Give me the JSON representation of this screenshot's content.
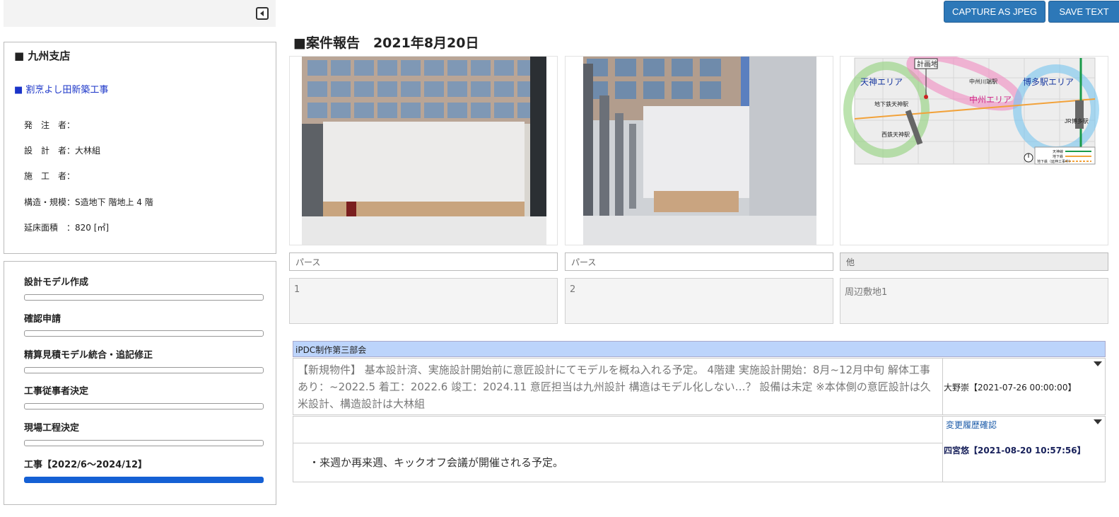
{
  "toolbar": {
    "capture_label": "CAPTURE AS JPEG",
    "save_label": "SAVE TEXT"
  },
  "info": {
    "branch": "■ 九州支店",
    "project": "■ 割烹よし田新築工事",
    "rows": [
      {
        "label": "発　注　者：",
        "value": ""
      },
      {
        "label": "設　計　者：",
        "value": "大林組"
      },
      {
        "label": "施　工　者：",
        "value": ""
      },
      {
        "label": "構造・規模：",
        "value": "S造地下 階地上 4 階"
      },
      {
        "label": "延床面積　：",
        "value": "820 [㎡]"
      }
    ]
  },
  "steps": [
    {
      "label": "設計モデル作成",
      "done": false
    },
    {
      "label": "確認申請",
      "done": false
    },
    {
      "label": "精算見積モデル統合・追記修正",
      "done": false
    },
    {
      "label": "工事従事者決定",
      "done": false
    },
    {
      "label": "現場工程決定",
      "done": false
    },
    {
      "label": "工事【2022/6～2024/12】",
      "done": true
    }
  ],
  "report": {
    "title": "■案件報告　2021年8月20日"
  },
  "images": [
    {
      "caption": "パース",
      "note": "1",
      "kind": "facade"
    },
    {
      "caption": "パース",
      "note": "2",
      "kind": "perspective"
    },
    {
      "caption": "他",
      "note": "周辺敷地1",
      "kind": "map"
    }
  ],
  "map_labels": {
    "site": "計画地",
    "tenjin": "天神エリア",
    "hakata": "博多駅エリア",
    "nakasu": "中州エリア",
    "nakasu_station": "中州川端駅",
    "chikatetsu_tenjin": "地下鉄天神駅",
    "nishitetsu_tenjin": "西鉄天神駅",
    "jr_hakata": "JR博多駅",
    "legend_1": "天神線",
    "legend_2": "地下鉄",
    "legend_3": "地下鉄（延伸工事中）"
  },
  "comments": {
    "section": "iPDC制作第三部会",
    "entries": [
      {
        "text": "【新規物件】 基本設計済、実施設計開始前に意匠設計にてモデルを概ね入れる予定。 4階建 実施設計開始：8月~12月中旬 解体工事あり：~2022.5 着工：2022.6 竣工：2024.11 意匠担当は九州設計 構造はモデル化しない…？ 設備は未定 ※本体側の意匠設計は久米設計、構造設計は大林組",
        "author": "大野崇【2021-07-26 00:00:00】"
      },
      {
        "text": "・来週か再来週、キックオフ会議が開催される予定。",
        "author": "四宮悠【2021-08-20 10:57:56】",
        "history_link": "変更履歴確認"
      }
    ]
  },
  "colors": {
    "accent": "#2d78b8",
    "progress": "#1560d4",
    "section_header": "#bcd4fb"
  }
}
